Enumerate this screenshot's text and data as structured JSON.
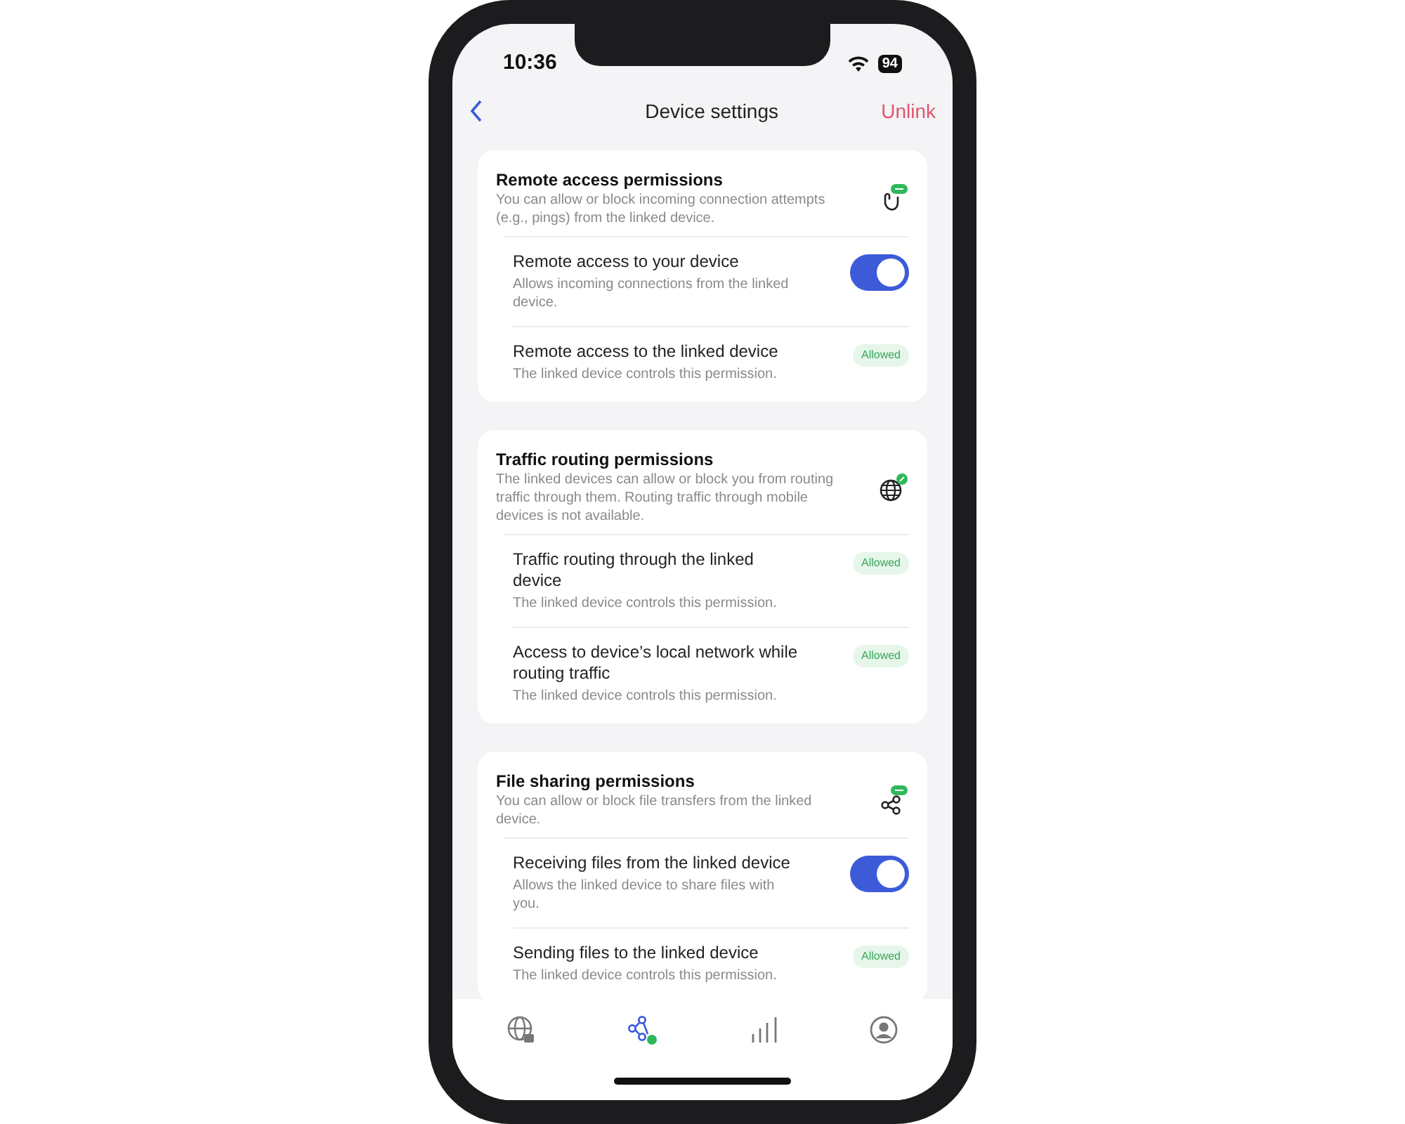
{
  "status_bar": {
    "time": "10:36",
    "battery": "94"
  },
  "nav": {
    "title": "Device settings",
    "action": "Unlink"
  },
  "sections": [
    {
      "title": "Remote access permissions",
      "description": "You can allow or block incoming connection attempts (e.g., pings) from the linked device.",
      "rows": [
        {
          "kind": "toggle",
          "title": "Remote access to your device",
          "description": "Allows incoming connections from the linked device.",
          "on": true
        },
        {
          "kind": "status",
          "title": "Remote access to the linked device",
          "description": "The linked device controls this permission.",
          "badge": "Allowed"
        }
      ]
    },
    {
      "title": "Traffic routing permissions",
      "description": "The linked devices can allow or block you from routing traffic through them. Routing traffic through mobile devices is not available.",
      "rows": [
        {
          "kind": "status",
          "title": "Traffic routing through the linked device",
          "description": "The linked device controls this permission.",
          "badge": "Allowed"
        },
        {
          "kind": "status",
          "title": "Access to device’s local network while routing traffic",
          "description": "The linked device controls this permission.",
          "badge": "Allowed"
        }
      ]
    },
    {
      "title": "File sharing permissions",
      "description": "You can allow or block file transfers from the linked device.",
      "rows": [
        {
          "kind": "toggle",
          "title": "Receiving files from the linked device",
          "description": "Allows the linked device to share files with you.",
          "on": true
        },
        {
          "kind": "status",
          "title": "Sending files to the linked device",
          "description": "The linked device controls this permission.",
          "badge": "Allowed"
        }
      ]
    }
  ],
  "tab_bar": [
    {
      "selected": false
    },
    {
      "selected": true
    },
    {
      "selected": false
    },
    {
      "selected": false
    }
  ]
}
